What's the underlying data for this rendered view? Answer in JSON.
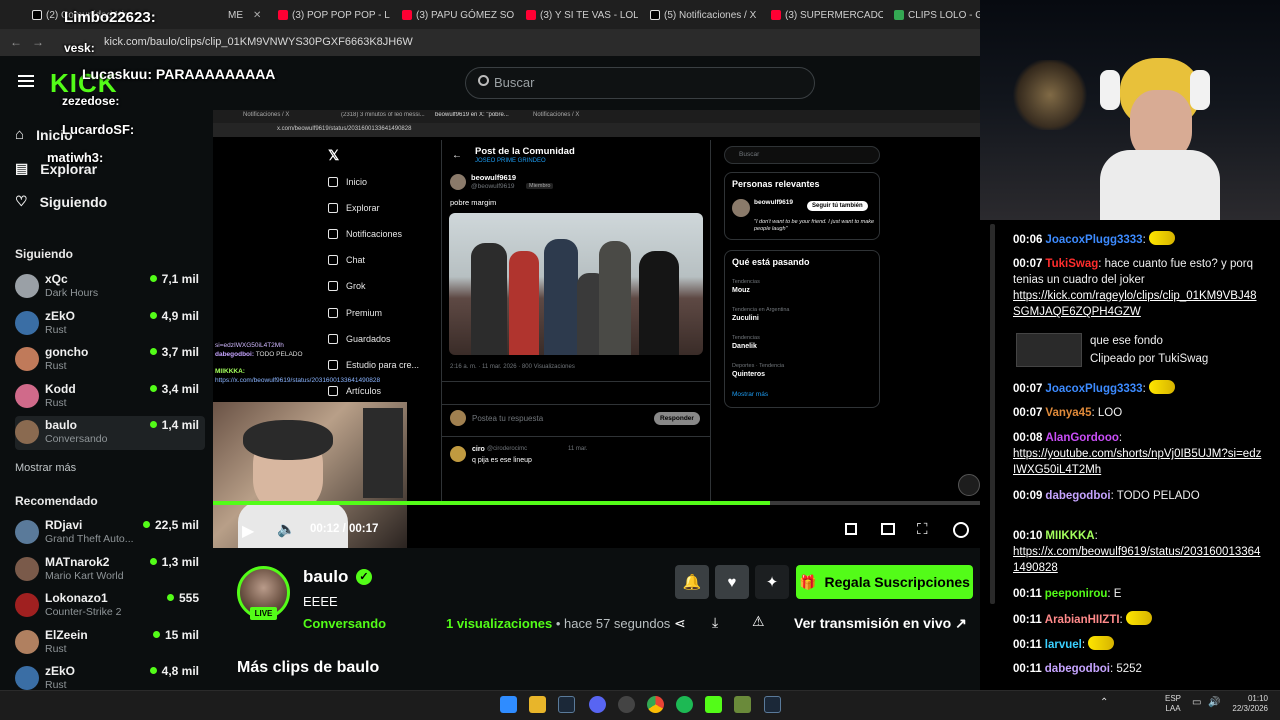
{
  "browser": {
    "tabs": [
      {
        "label": "(2) Comunidad Kick",
        "color": "#ffffff"
      },
      {
        "label": "ME",
        "color": "#ff0033"
      },
      {
        "label": "(3) POP POP POP - LI",
        "color": "#ff0033"
      },
      {
        "label": "(3) PAPU GÓMEZ SOI",
        "color": "#ff0033"
      },
      {
        "label": "(3) Y SI TE VAS - LOLI",
        "color": "#ff0033"
      },
      {
        "label": "(5) Notificaciones / X",
        "color": "#ffffff"
      },
      {
        "label": "(3) SUPERMERCADO",
        "color": "#ff0033"
      },
      {
        "label": "CLIPS LOLO - Googl",
        "color": "#34a853"
      }
    ],
    "url": "kick.com/baulo/clips/clip_01KM9VNWYS30PGXF6663K8JH6W"
  },
  "kick_header": {
    "search_placeholder": "Buscar"
  },
  "sidebar": {
    "nav": [
      {
        "label": "Inicio",
        "icon": "home-icon"
      },
      {
        "label": "Explorar",
        "icon": "compass-icon"
      },
      {
        "label": "Siguiendo",
        "icon": "heart-icon"
      }
    ],
    "following_title": "Siguiendo",
    "following": [
      {
        "name": "xQc",
        "category": "Dark Hours",
        "viewers": "7,1 mil",
        "color": "#9aa0a6"
      },
      {
        "name": "zEkO",
        "category": "Rust",
        "viewers": "4,9 mil",
        "color": "#3a6ea5"
      },
      {
        "name": "goncho",
        "category": "Rust",
        "viewers": "3,7 mil",
        "color": "#c07a5a"
      },
      {
        "name": "Kodd",
        "category": "Rust",
        "viewers": "3,4 mil",
        "color": "#d06a8a"
      },
      {
        "name": "baulo",
        "category": "Conversando",
        "viewers": "1,4 mil",
        "color": "#8a6a50"
      }
    ],
    "show_more": "Mostrar más",
    "recommended_title": "Recomendado",
    "recommended": [
      {
        "name": "RDjavi",
        "category": "Grand Theft Auto...",
        "viewers": "22,5 mil",
        "color": "#5a7a9a"
      },
      {
        "name": "MATnarok2",
        "category": "Mario Kart World",
        "viewers": "1,3 mil",
        "color": "#7a5a4a"
      },
      {
        "name": "Lokonazo1",
        "category": "Counter-Strike 2",
        "viewers": "555",
        "color": "#a02020"
      },
      {
        "name": "ElZeein",
        "category": "Rust",
        "viewers": "15 mil",
        "color": "#b08060"
      },
      {
        "name": "zEkO",
        "category": "Rust",
        "viewers": "4,8 mil",
        "color": "#3a6ea5"
      }
    ]
  },
  "overlay_names": [
    {
      "name": "Limbo22623:",
      "color": "#ffd400"
    },
    {
      "name": "vesk:",
      "color": "#ffffff"
    },
    {
      "name": "Lucaskuu: PARAAAAAAAAA",
      "color": "#ffffff"
    },
    {
      "name": "zezedose:",
      "color": "#ff4d4d"
    },
    {
      "name": "LucardoSF:",
      "color": "#ffffff"
    },
    {
      "name": "matiwh3:",
      "color": "#ffffff"
    }
  ],
  "video": {
    "inner_tabs": [
      "Notificaciones / X",
      "(2318) 3 minutos of leo messi...",
      "beowulf9619 en X: \"pobre...",
      "Notificaciones / X"
    ],
    "inner_url": "x.com/beowulf9619/status/2031600133641490828",
    "x_nav": [
      "Inicio",
      "Explorar",
      "Notificaciones",
      "Chat",
      "Grok",
      "Premium",
      "Guardados",
      "Estudio para cre...",
      "Artículos"
    ],
    "post_header": "Post de la Comunidad",
    "post_community": "JOSEO PRIME GRINDEO",
    "post_author": "beowulf9619",
    "post_handle": "@beowulf9619",
    "post_badge": "Miembro",
    "post_text": "pobre margim",
    "post_meta": "2:16 a. m. · 11 mar. 2026 · 800 Visualizaciones",
    "reply_placeholder": "Postea tu respuesta",
    "reply_button": "Responder",
    "reply_author": "ciro",
    "reply_handle": "@ciroderocimc",
    "reply_text": "q pija es ese lineup",
    "reply_time": "11 mar.",
    "right_search": "Buscar",
    "relevant_title": "Personas relevantes",
    "relevant_name": "beowulf9619",
    "relevant_button": "Seguir tú también",
    "relevant_bio": "\"I don't want to be your friend. I just want to make people laugh\"",
    "trending_title": "Qué está pasando",
    "trends": [
      {
        "context": "Tendencias",
        "topic": "Mouz"
      },
      {
        "context": "Tendencia en Argentina",
        "topic": "Zuculini"
      },
      {
        "context": "Tendencias",
        "topic": "Danelik"
      },
      {
        "context": "Deportes · Tendencia",
        "topic": "Quinteros"
      }
    ],
    "show_more": "Mostrar más",
    "chat_overlay": [
      {
        "user": "dabegodboi:",
        "text": "TODO PELADO"
      },
      {
        "user": "MIIKKKA:",
        "text": "https://x.com/beowulf9619/status/2031600133641490828"
      }
    ],
    "overlay_link_top": "si=edzIWXG50iL4T2Mh",
    "time_current": "00:12",
    "time_total": "00:17",
    "progress_fraction": 0.71
  },
  "clip": {
    "channel": "baulo",
    "title": "EEEE",
    "category": "Conversando",
    "live_badge": "LIVE",
    "views_count": "1",
    "views_label": "visualizaciones",
    "time_ago": "hace 57 segundos",
    "gift_button": "Regala Suscripciones",
    "watch_live": "Ver transmisión en vivo",
    "more_clips": "Más clips de baulo"
  },
  "chat": {
    "messages": [
      {
        "time": "00:06",
        "user": "JoacoxPlugg3333",
        "color": "#3d8bff",
        "text": ""
      },
      {
        "time": "00:07",
        "user": "TukiSwag",
        "color": "#ff2d2d",
        "text": "hace cuanto fue esto? y porq tenias un cuadro del joker",
        "link": "https://kick.com/rageylo/clips/clip_01KM9VBJ48SGMJAQE6ZQPH4GZW"
      },
      {
        "time": "",
        "user": "",
        "color": "",
        "text": "que ese fondo",
        "sub": "Clipeado por TukiSwag"
      },
      {
        "time": "00:07",
        "user": "JoacoxPlugg3333",
        "color": "#3d8bff",
        "text": ""
      },
      {
        "time": "00:07",
        "user": "Vanya45",
        "color": "#e08a3a",
        "text": "LOO"
      },
      {
        "time": "00:08",
        "user": "AlanGordooo",
        "color": "#c94ef7",
        "text": "",
        "link": "https://youtube.com/shorts/npVj0IB5UJM?si=edzIWXG50iL4T2Mh"
      },
      {
        "time": "00:09",
        "user": "dabegodboi",
        "color": "#c6a4ff",
        "text": "TODO PELADO"
      },
      {
        "time": "00:10",
        "user": "MIIKKKA",
        "color": "#a3ff5c",
        "text": "",
        "link": "https://x.com/beowulf9619/status/2031600133641490828"
      },
      {
        "time": "00:11",
        "user": "peeponirou",
        "color": "#53fc18",
        "text": "E"
      },
      {
        "time": "00:11",
        "user": "ArabianHIIZTI",
        "color": "#ff8a8a",
        "text": ""
      },
      {
        "time": "00:11",
        "user": "larvuel",
        "color": "#3ad0ff",
        "text": ""
      },
      {
        "time": "00:11",
        "user": "dabegodboi",
        "color": "#c6a4ff",
        "text": "5252"
      }
    ]
  },
  "taskbar": {
    "lang_top": "ESP",
    "lang_bottom": "LAA",
    "time": "01:10",
    "date": "22/3/2026"
  },
  "colors": {
    "kick_green": "#53fc18",
    "background": "#0b0e0f"
  }
}
